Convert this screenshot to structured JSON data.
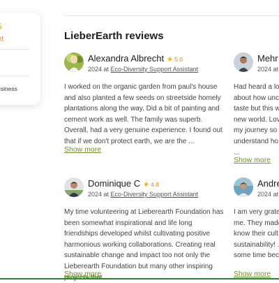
{
  "side_card": {
    "rating_fragment": "5",
    "rating_sub_fragment": "nt",
    "category_fragment": "usiness"
  },
  "section": {
    "title": "LieberEarth reviews"
  },
  "reviews": [
    {
      "name": "Alexandra Albrecht",
      "rating": "5.0",
      "year_prefix": "2024 at",
      "role": "Eco-Diversity Support Assistant",
      "text": "I worked on the organic garden from paul's house and also planted a few seeds on streetside homely plantations along the way. Did a bit of painting and cement work as well. The family was superb. Overall, had a very genuine experience. I found out that if we don't protect earth, we are the ...",
      "more_label": "Show more",
      "avatar_icon": "user-photo"
    },
    {
      "name": "Dominique C",
      "rating": "4.8",
      "year_prefix": "2024 at",
      "role": "Eco-Diversity Support Assistant",
      "text": "My time volunteering at Lieberearth Foundation has been somewhat inspirational and life long friendships developed whilst cultivating positive harmonious working collaborations. Creating real sustainable change and impact too not only the Lieberearth Foundation but many other inspiring projects that ...",
      "more_label": "Show more",
      "avatar_icon": "user-photo"
    },
    {
      "name": "Mehr I",
      "year_prefix": "2024 at",
      "text_lines": [
        "Had heard a lo",
        "about how unc",
        "taste but this w",
        "new world. Lov",
        "my journey so",
        "understand ho",
        "..."
      ],
      "more_label": "Show more",
      "avatar_icon": "user-photo"
    },
    {
      "name": "Andre",
      "year_prefix": "2024 at",
      "text_lines": [
        "I am very grate",
        "me. They made",
        "know their cult",
        "sustainability! .",
        "some time bec"
      ],
      "more_label": "Show more",
      "avatar_icon": "user-photo"
    }
  ],
  "colors": {
    "star": "#f2b400",
    "rating_text": "#c79100",
    "link_green": "#6e8f2d",
    "bottom_bar": "#2e7d32"
  }
}
